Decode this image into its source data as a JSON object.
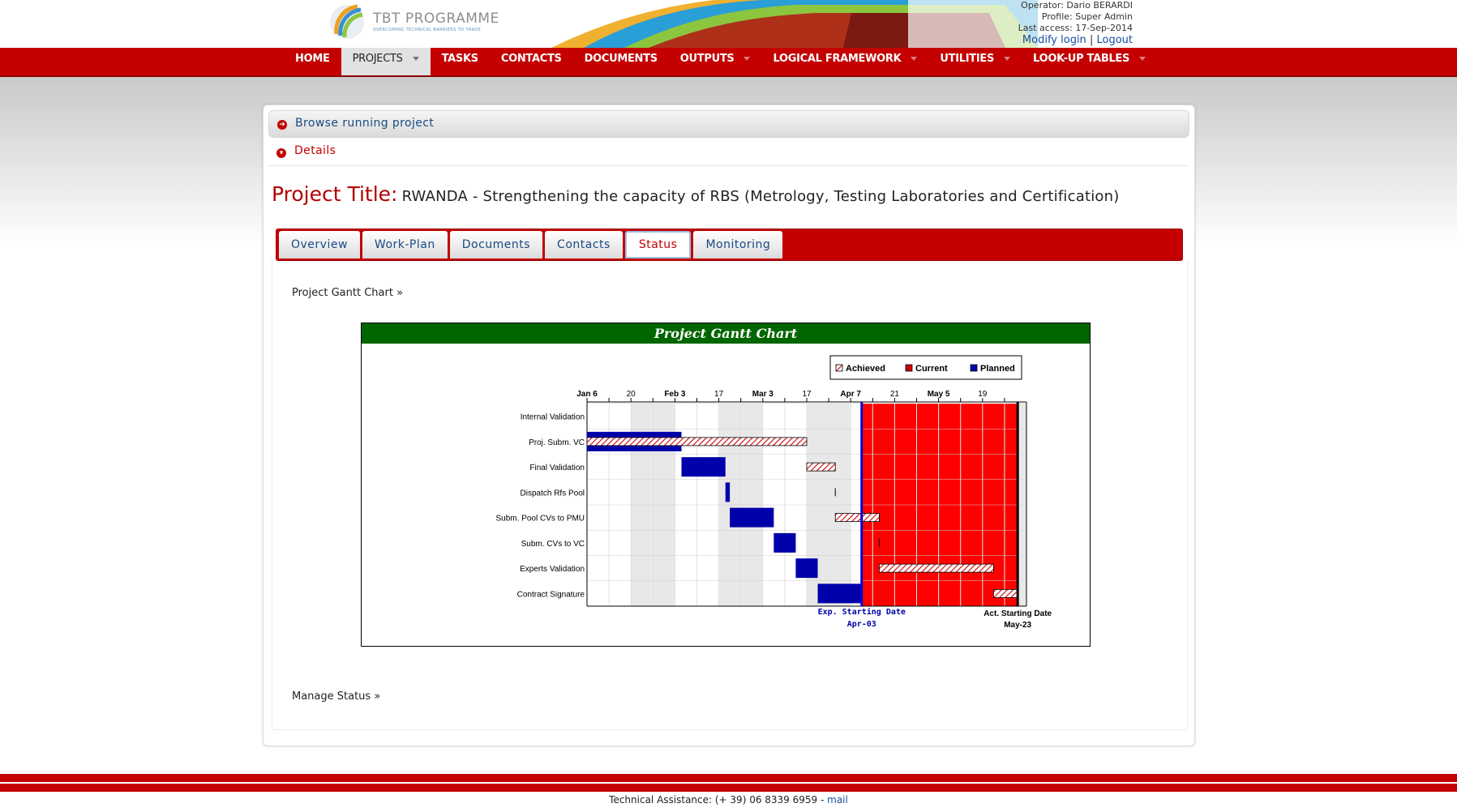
{
  "header": {
    "logo_name": "TBT PROGRAMME",
    "logo_tagline": "OVERCOMING TECHNICAL BARRIERS TO TRADE",
    "operator": "Operator: Dario BERARDI",
    "profile": "Profile: Super Admin",
    "last_access": "Last access: 17-Sep-2014",
    "modify_login": "Modify login",
    "separator": "|",
    "logout": "Logout"
  },
  "nav": {
    "items": [
      {
        "label": "HOME",
        "dropdown": false,
        "active": false
      },
      {
        "label": "PROJECTS",
        "dropdown": true,
        "active": true
      },
      {
        "label": "TASKS",
        "dropdown": false,
        "active": false
      },
      {
        "label": "CONTACTS",
        "dropdown": false,
        "active": false
      },
      {
        "label": "DOCUMENTS",
        "dropdown": false,
        "active": false
      },
      {
        "label": "OUTPUTS",
        "dropdown": true,
        "active": false
      },
      {
        "label": "LOGICAL FRAMEWORK",
        "dropdown": true,
        "active": false
      },
      {
        "label": "UTILITIES",
        "dropdown": true,
        "active": false
      },
      {
        "label": "LOOK-UP TABLES",
        "dropdown": true,
        "active": false
      }
    ]
  },
  "panel": {
    "browse_label": "Browse running project",
    "details_label": "Details",
    "project_title_key": "Project Title:",
    "project_title_value": "RWANDA - Strengthening the capacity of RBS (Metrology, Testing Laboratories and Certification)",
    "tabs": [
      {
        "label": "Overview",
        "active": false
      },
      {
        "label": "Work-Plan",
        "active": false
      },
      {
        "label": "Documents",
        "active": false
      },
      {
        "label": "Contacts",
        "active": false
      },
      {
        "label": "Status",
        "active": true
      },
      {
        "label": "Monitoring",
        "active": false
      }
    ],
    "gantt_link": "Project Gantt Chart »",
    "manage_link": "Manage Status »"
  },
  "chart_data": {
    "type": "gantt",
    "title": "Project Gantt Chart",
    "legend": [
      "Achieved",
      "Current",
      "Planned"
    ],
    "legend_position": "top-right",
    "colors": {
      "title_bg": "#006600",
      "planned": "#0000aa",
      "current": "#ff0000",
      "achieved_hatch": "#cc0000",
      "marker": "#0000cc"
    },
    "time_unit": "week",
    "week_labels": [
      "Jan 6",
      "",
      "20",
      "",
      "Feb 3",
      "",
      "17",
      "",
      "Mar 3",
      "",
      "17",
      "",
      "Apr 7",
      "",
      "21",
      "",
      "May 5",
      "",
      "19",
      ""
    ],
    "tasks": [
      {
        "name": "Internal Validation",
        "planned": null,
        "achieved": null
      },
      {
        "name": "Proj. Subm. VC",
        "planned": [
          0,
          4.3
        ],
        "achieved": [
          0,
          10
        ]
      },
      {
        "name": "Final Validation",
        "planned": [
          4.3,
          6.3
        ],
        "achieved": [
          10,
          11.3
        ]
      },
      {
        "name": "Dispatch Rfs Pool",
        "planned": [
          6.3,
          6.5
        ],
        "achieved": [
          11.3,
          11.35
        ]
      },
      {
        "name": "Subm. Pool CVs to PMU",
        "planned": [
          6.5,
          8.5
        ],
        "achieved": [
          11.3,
          13.3
        ]
      },
      {
        "name": "Subm. CVs to VC",
        "planned": [
          8.5,
          9.5
        ],
        "achieved": [
          13.3,
          13.35
        ]
      },
      {
        "name": "Experts Validation",
        "planned": [
          9.5,
          10.5
        ],
        "achieved": [
          13.3,
          18.5
        ]
      },
      {
        "name": "Contract Signature",
        "planned": [
          10.5,
          12.5
        ],
        "achieved": [
          18.5,
          19.6
        ]
      }
    ],
    "current_period": [
      12.5,
      19.6
    ],
    "markers": [
      {
        "label": "Exp. Starting Date",
        "date": "Apr-03",
        "week": 12.5
      },
      {
        "label": "Act. Starting Date",
        "date": "May-23",
        "week": 19.6
      }
    ]
  },
  "footer": {
    "text": "Technical Assistance: (+ 39) 06 8339 6959 - ",
    "mail": "mail"
  }
}
